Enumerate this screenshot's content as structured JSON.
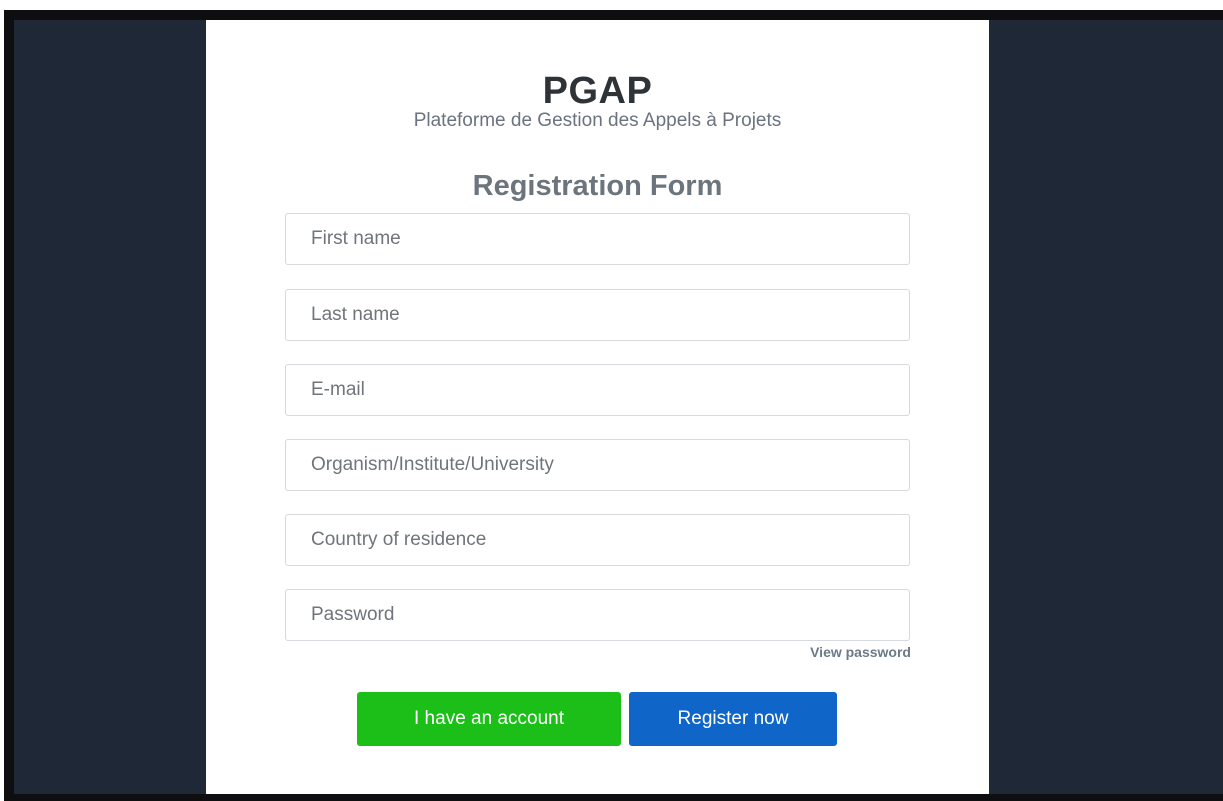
{
  "app": {
    "title": "PGAP",
    "subtitle": "Plateforme de Gestion des Appels à Projets"
  },
  "form": {
    "title": "Registration Form",
    "fields": {
      "first_name": {
        "placeholder": "First name",
        "value": ""
      },
      "last_name": {
        "placeholder": "Last name",
        "value": ""
      },
      "email": {
        "placeholder": "E-mail",
        "value": ""
      },
      "organism": {
        "placeholder": "Organism/Institute/University",
        "value": ""
      },
      "country": {
        "placeholder": "Country of residence",
        "value": ""
      },
      "password": {
        "placeholder": "Password",
        "value": ""
      }
    },
    "view_password_label": "View password",
    "buttons": {
      "have_account": "I have an account",
      "register": "Register now"
    }
  },
  "colors": {
    "background": "#1f2836",
    "card": "#ffffff",
    "login_button": "#1bbf18",
    "register_button": "#0f66c8"
  }
}
